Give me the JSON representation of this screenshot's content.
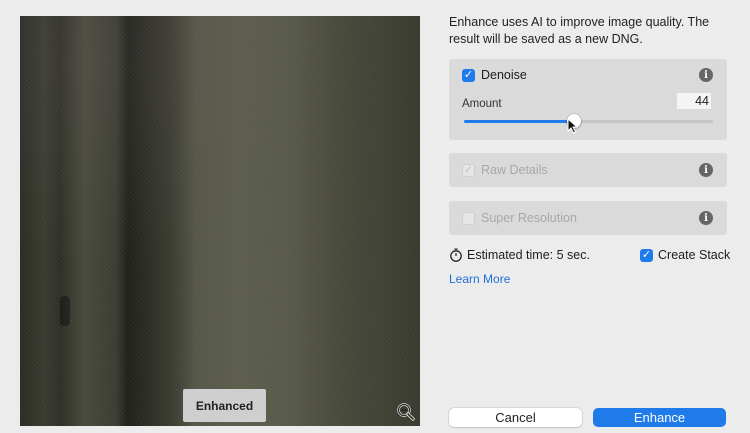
{
  "preview": {
    "badge_label": "Enhanced"
  },
  "description": "Enhance uses AI to improve image quality. The result will be saved as a new DNG.",
  "denoise": {
    "label": "Denoise",
    "checked": true,
    "amount_label": "Amount",
    "amount_value": "44",
    "amount_percent": 44
  },
  "raw_details": {
    "label": "Raw Details",
    "checked": true,
    "enabled": false
  },
  "super_resolution": {
    "label": "Super Resolution",
    "checked": false,
    "enabled": false
  },
  "estimated_time": "Estimated time: 5 sec.",
  "create_stack": {
    "label": "Create Stack",
    "checked": true
  },
  "learn_more": "Learn More",
  "buttons": {
    "cancel": "Cancel",
    "enhance": "Enhance"
  },
  "colors": {
    "accent": "#1f7bea",
    "panel": "#dadada",
    "background": "#ececec"
  }
}
